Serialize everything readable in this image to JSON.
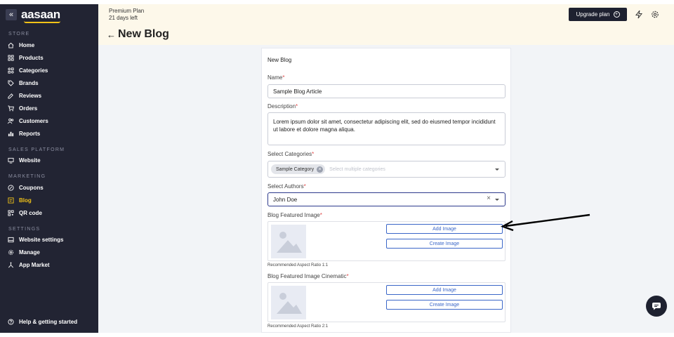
{
  "sidebar": {
    "logo": "aasaan",
    "sections": [
      {
        "label": "STORE",
        "items": [
          {
            "label": "Home",
            "icon": "home-icon"
          },
          {
            "label": "Products",
            "icon": "grid-icon"
          },
          {
            "label": "Categories",
            "icon": "category-icon"
          },
          {
            "label": "Brands",
            "icon": "tag-icon"
          },
          {
            "label": "Reviews",
            "icon": "review-icon"
          },
          {
            "label": "Orders",
            "icon": "cart-icon"
          },
          {
            "label": "Customers",
            "icon": "users-icon"
          },
          {
            "label": "Reports",
            "icon": "chart-icon"
          }
        ]
      },
      {
        "label": "SALES PLATFORM",
        "items": [
          {
            "label": "Website",
            "icon": "monitor-icon"
          }
        ]
      },
      {
        "label": "MARKETING",
        "items": [
          {
            "label": "Coupons",
            "icon": "coupon-icon"
          },
          {
            "label": "Blog",
            "icon": "blog-icon",
            "active": true
          },
          {
            "label": "QR code",
            "icon": "qr-icon"
          }
        ]
      },
      {
        "label": "SETTINGS",
        "items": [
          {
            "label": "Website settings",
            "icon": "website-settings-icon"
          },
          {
            "label": "Manage",
            "icon": "gear-icon"
          },
          {
            "label": "App Market",
            "icon": "app-market-icon"
          }
        ]
      }
    ],
    "help": "Help & getting started"
  },
  "topbar": {
    "plan_name": "Premium Plan",
    "plan_days": "21 days left",
    "upgrade_label": "Upgrade plan",
    "page_title": "New Blog"
  },
  "form": {
    "card_title": "New Blog",
    "name_label": "Name",
    "name_value": "Sample Blog Article",
    "description_label": "Description",
    "description_value": "Lorem ipsum dolor sit amet, consectetur adipiscing elit, sed do eiusmed tempor incididunt ut labore et dolore magna aliqua.",
    "categories_label": "Select Categories",
    "category_chip": "Sample Category",
    "categories_placeholder": "Select multiple categories",
    "authors_label": "Select Authors",
    "authors_value": "John Doe",
    "featured_label": "Blog Featured Image",
    "featured_hint": "Recommended Aspect Ratio 1:1",
    "cinematic_label": "Blog Featured Image Cinematic",
    "cinematic_hint": "Recommended Aspect Ratio 2:1",
    "add_image": "Add Image",
    "create_image": "Create Image",
    "required_mark": "*"
  },
  "colors": {
    "sidebar_bg": "#222433",
    "accent": "#f2c318",
    "topbar_bg": "#fdf8ea",
    "button_blue": "#3b67c8"
  }
}
